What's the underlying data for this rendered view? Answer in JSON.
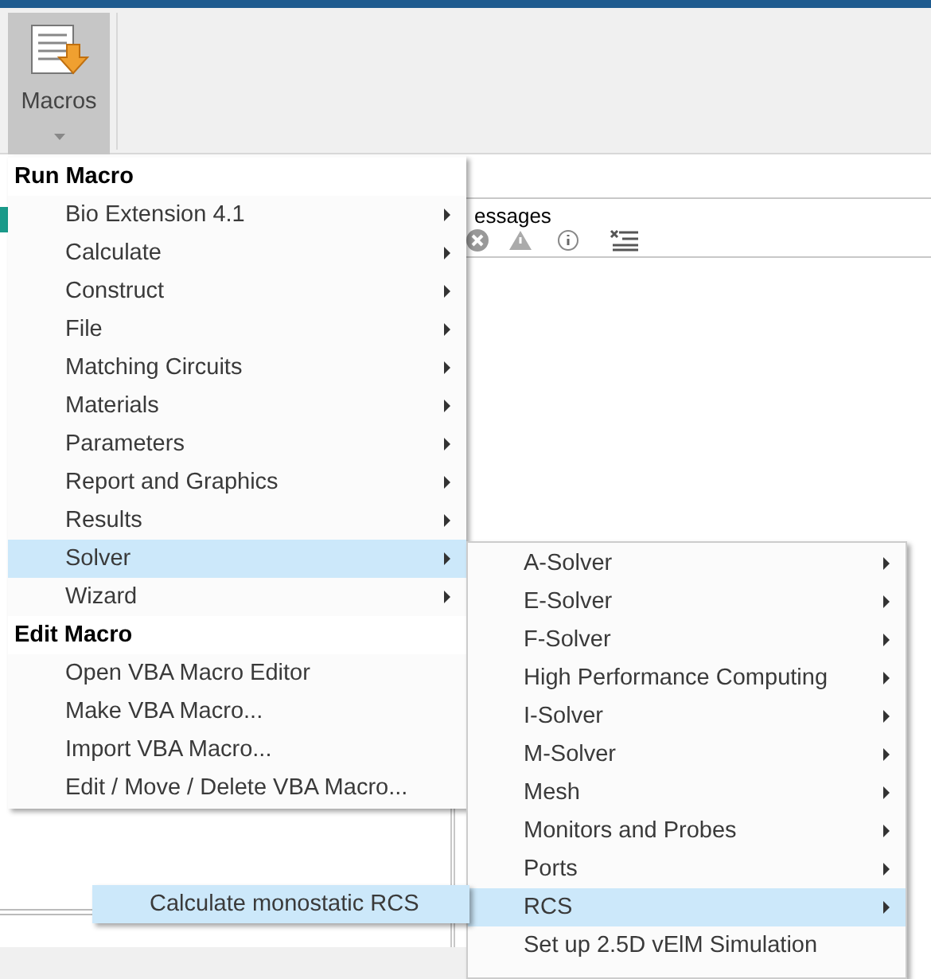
{
  "ribbon": {
    "macros_button": {
      "label": "Macros",
      "selected": true
    }
  },
  "messages_panel": {
    "title": "essages"
  },
  "run_macro_menu": {
    "sections": [
      {
        "header": "Run Macro",
        "items": [
          {
            "label": "Bio Extension 4.1",
            "submenu": true,
            "selected": false
          },
          {
            "label": "Calculate",
            "submenu": true,
            "selected": false
          },
          {
            "label": "Construct",
            "submenu": true,
            "selected": false
          },
          {
            "label": "File",
            "submenu": true,
            "selected": false
          },
          {
            "label": "Matching Circuits",
            "submenu": true,
            "selected": false
          },
          {
            "label": "Materials",
            "submenu": true,
            "selected": false
          },
          {
            "label": "Parameters",
            "submenu": true,
            "selected": false
          },
          {
            "label": "Report and Graphics",
            "submenu": true,
            "selected": false
          },
          {
            "label": "Results",
            "submenu": true,
            "selected": false
          },
          {
            "label": "Solver",
            "submenu": true,
            "selected": true
          },
          {
            "label": "Wizard",
            "submenu": true,
            "selected": false
          }
        ]
      },
      {
        "header": "Edit Macro",
        "items": [
          {
            "label": "Open VBA Macro Editor",
            "submenu": false,
            "selected": false
          },
          {
            "label": "Make VBA Macro...",
            "submenu": false,
            "selected": false
          },
          {
            "label": "Import VBA Macro...",
            "submenu": false,
            "selected": false
          },
          {
            "label": "Edit / Move / Delete VBA Macro...",
            "submenu": false,
            "selected": false
          }
        ]
      }
    ]
  },
  "solver_submenu": {
    "items": [
      {
        "label": "A-Solver",
        "submenu": true,
        "selected": false
      },
      {
        "label": "E-Solver",
        "submenu": true,
        "selected": false
      },
      {
        "label": "F-Solver",
        "submenu": true,
        "selected": false
      },
      {
        "label": "High Performance Computing",
        "submenu": true,
        "selected": false
      },
      {
        "label": "I-Solver",
        "submenu": true,
        "selected": false
      },
      {
        "label": "M-Solver",
        "submenu": true,
        "selected": false
      },
      {
        "label": "Mesh",
        "submenu": true,
        "selected": false
      },
      {
        "label": "Monitors and Probes",
        "submenu": true,
        "selected": false
      },
      {
        "label": "Ports",
        "submenu": true,
        "selected": false
      },
      {
        "label": "RCS",
        "submenu": true,
        "selected": true
      },
      {
        "label": "Set up 2.5D vElM Simulation",
        "submenu": false,
        "selected": false
      }
    ]
  },
  "rcs_submenu": {
    "items": [
      {
        "label": "Calculate monostatic RCS",
        "submenu": false,
        "selected": true
      }
    ]
  }
}
